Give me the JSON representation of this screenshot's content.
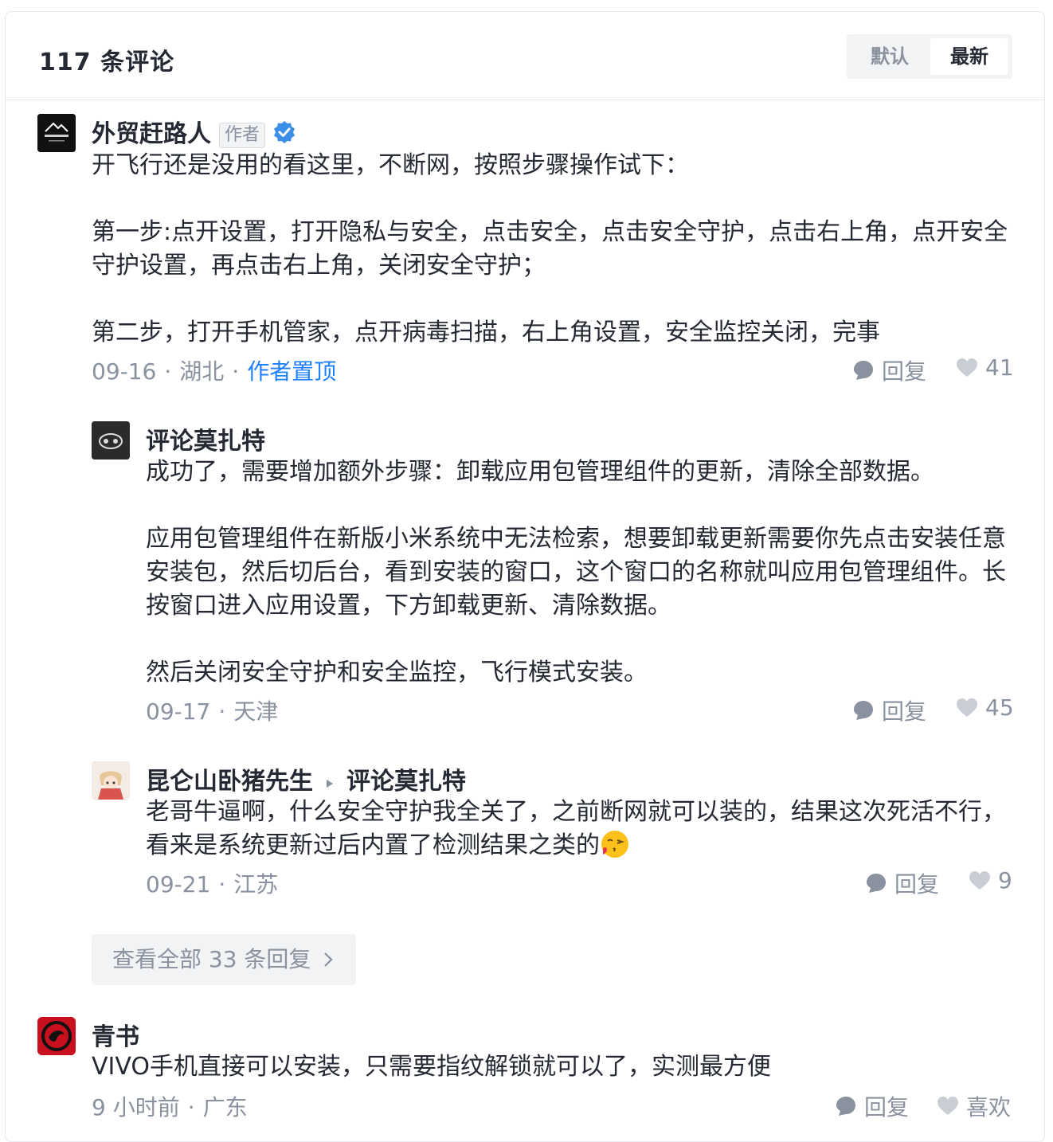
{
  "header": {
    "title": "117 条评论",
    "sort_default": "默认",
    "sort_latest": "最新"
  },
  "comments": [
    {
      "author": "外贸赶路人",
      "author_badge": "作者",
      "avatar_text": "外贸赶路人",
      "content": "开飞行还是没用的看这里，不断网，按照步骤操作试下：\n\n第一步:点开设置，打开隐私与安全，点击安全，点击安全守护，点击右上角，点开安全守护设置，再点击右上角，关闭安全守护；\n\n第二步，打开手机管家，点开病毒扫描，右上角设置，安全监控关闭，完事",
      "date": "09-16",
      "location": "湖北",
      "pinned": "作者置顶",
      "reply_label": "回复",
      "likes": "41"
    },
    {
      "author": "评论莫扎特",
      "content": "成功了，需要增加额外步骤：卸载应用包管理组件的更新，清除全部数据。\n\n应用包管理组件在新版小米系统中无法检索，想要卸载更新需要你先点击安装任意安装包，然后切后台，看到安装的窗口，这个窗口的名称就叫应用包管理组件。长按窗口进入应用设置，下方卸载更新、清除数据。\n\n然后关闭安全守护和安全监控，飞行模式安装。",
      "date": "09-17",
      "location": "天津",
      "reply_label": "回复",
      "likes": "45"
    },
    {
      "author": "昆仑山卧猪先生",
      "reply_to": "评论莫扎特",
      "content": "老哥牛逼啊，什么安全守护我全关了，之前断网就可以装的，结果这次死活不行，看来是系统更新过后内置了检测结果之类的",
      "date": "09-21",
      "location": "江苏",
      "reply_label": "回复",
      "likes": "9"
    },
    {
      "author": "青书",
      "content": "VIVO手机直接可以安装，只需要指纹解锁就可以了，实测最方便",
      "date": "9 小时前",
      "location": "广东",
      "reply_label": "回复",
      "like_label": "喜欢"
    }
  ],
  "view_all_replies": "查看全部 33 条回复",
  "colors": {
    "text": "#252933",
    "muted": "#8a919f",
    "link": "#1e80ff",
    "border": "#e4e6eb",
    "tab_bg": "#f2f3f5"
  }
}
